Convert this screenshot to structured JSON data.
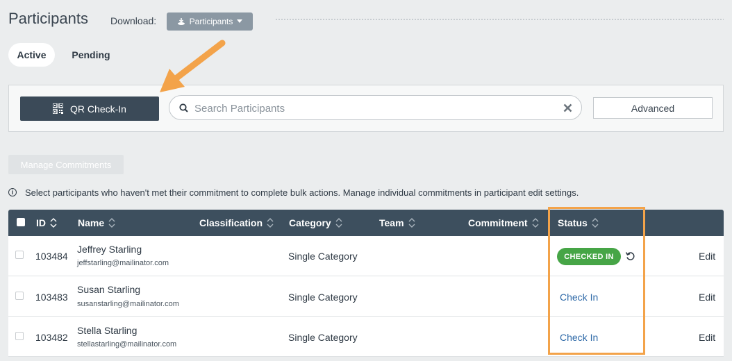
{
  "header": {
    "title": "Participants",
    "download_label": "Download:",
    "download_button": "Participants"
  },
  "tabs": [
    {
      "label": "Active",
      "active": true
    },
    {
      "label": "Pending",
      "active": false
    }
  ],
  "toolbar": {
    "qr_button": "QR Check-In",
    "search_placeholder": "Search Participants",
    "advanced_button": "Advanced"
  },
  "manage_button": "Manage Commitments",
  "info_text": "Select participants who haven't met their commitment to complete bulk actions. Manage individual commitments in participant edit settings.",
  "table": {
    "columns": [
      "ID",
      "Name",
      "Classification",
      "Category",
      "Team",
      "Commitment",
      "Status"
    ],
    "rows": [
      {
        "id": "103484",
        "name": "Jeffrey Starling",
        "email": "jeffstarling@mailinator.com",
        "category": "Single Category",
        "status": "CHECKED IN",
        "edit": "Edit"
      },
      {
        "id": "103483",
        "name": "Susan Starling",
        "email": "susanstarling@mailinator.com",
        "category": "Single Category",
        "status": "Check In",
        "edit": "Edit"
      },
      {
        "id": "103482",
        "name": "Stella Starling",
        "email": "stellastarling@mailinator.com",
        "category": "Single Category",
        "status": "Check In",
        "edit": "Edit"
      }
    ]
  },
  "colors": {
    "header_bg": "#3d4f5e",
    "checked_in": "#46a546",
    "link": "#2f6aa8",
    "highlight": "#f3a34a"
  }
}
